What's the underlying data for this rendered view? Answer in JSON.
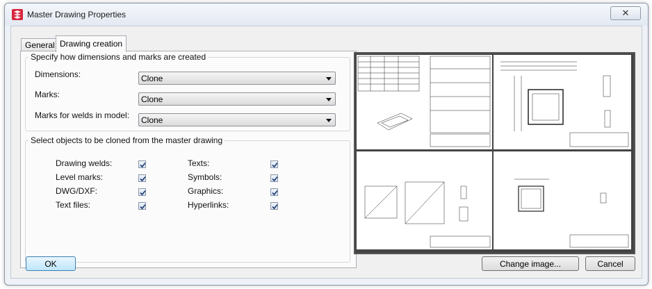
{
  "window": {
    "title": "Master Drawing Properties",
    "close_glyph": "✕"
  },
  "tabs": [
    {
      "label": "General"
    },
    {
      "label": "Drawing creation"
    }
  ],
  "dimensions_group": {
    "legend": "Specify how dimensions and marks are created",
    "rows": [
      {
        "label": "Dimensions:",
        "value": "Clone"
      },
      {
        "label": "Marks:",
        "value": "Clone"
      },
      {
        "label": "Marks for welds in model:",
        "value": "Clone"
      }
    ]
  },
  "clone_group": {
    "legend": "Select objects to be cloned from the master drawing",
    "left": [
      {
        "label": "Drawing welds:",
        "checked": true
      },
      {
        "label": "Level marks:",
        "checked": true
      },
      {
        "label": "DWG/DXF:",
        "checked": true
      },
      {
        "label": "Text files:",
        "checked": true
      }
    ],
    "right": [
      {
        "label": "Texts:",
        "checked": true
      },
      {
        "label": "Symbols:",
        "checked": true
      },
      {
        "label": "Graphics:",
        "checked": true
      },
      {
        "label": "Hyperlinks:",
        "checked": true
      }
    ]
  },
  "buttons": {
    "ok": "OK",
    "change_image": "Change image...",
    "cancel": "Cancel"
  },
  "icons": {
    "app": "tekla-app-icon",
    "check": "checkmark-icon"
  },
  "colors": {
    "app_icon": "#d7263d",
    "check": "#1f3a6e",
    "ok_border": "#3c7fb1"
  }
}
